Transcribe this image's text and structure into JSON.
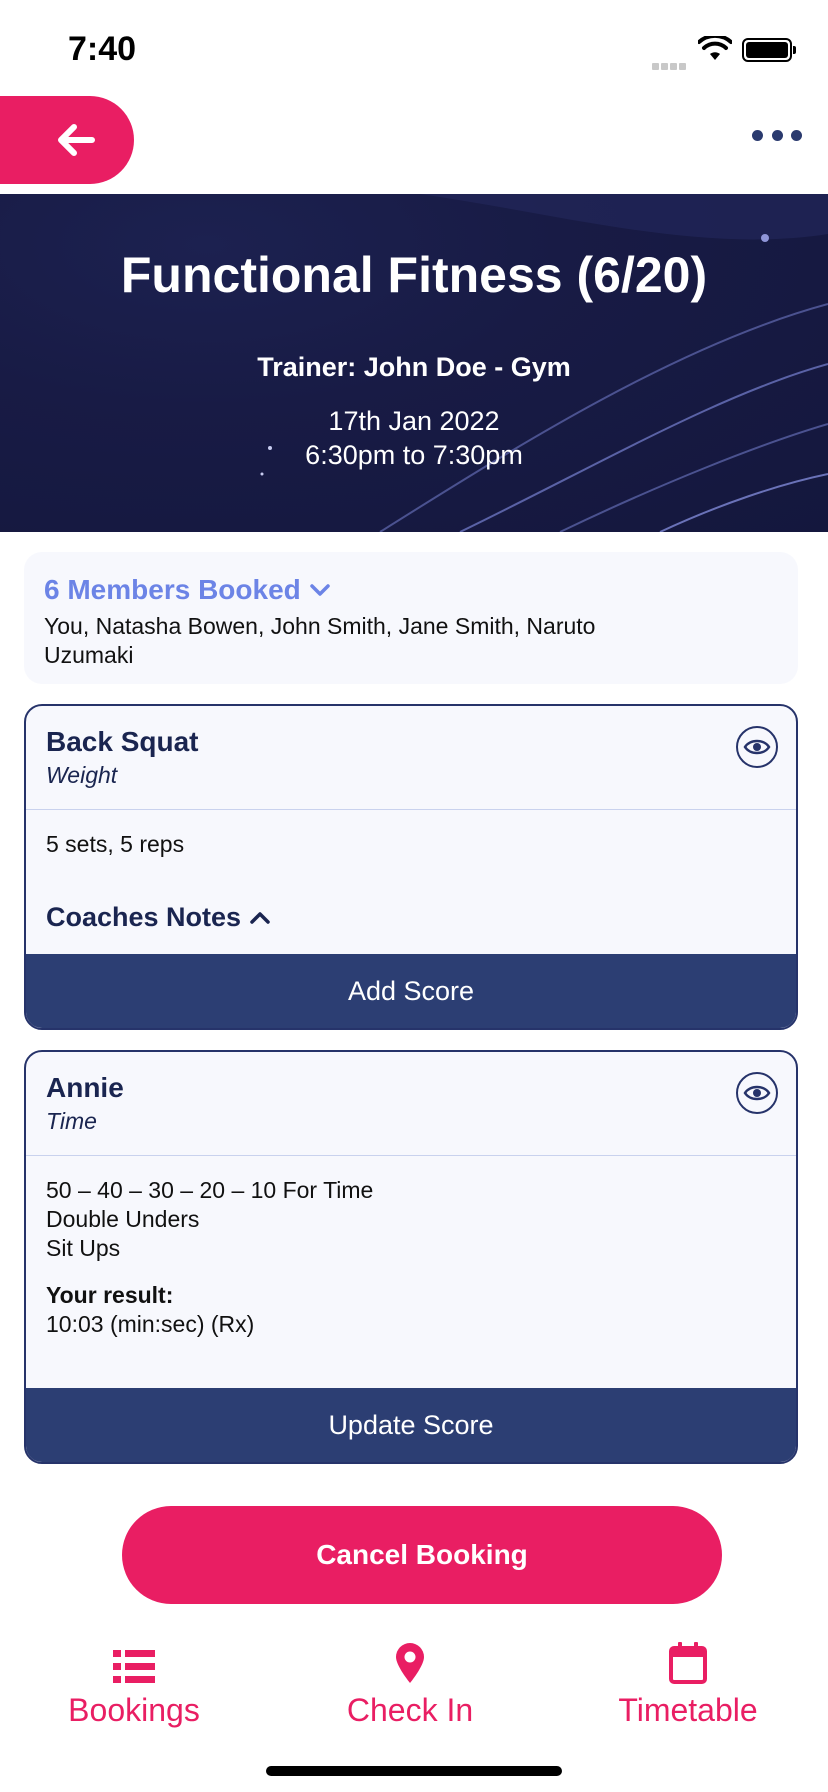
{
  "status_bar": {
    "time": "7:40"
  },
  "class": {
    "title": "Functional Fitness (6/20)",
    "trainer": "Trainer: John Doe - Gym",
    "date": "17th Jan 2022",
    "time_range": "6:30pm to 7:30pm"
  },
  "members": {
    "header": "6 Members Booked",
    "list": "You, Natasha Bowen, John Smith, Jane Smith, Naruto Uzumaki"
  },
  "workouts": [
    {
      "title": "Back Squat",
      "type": "Weight",
      "detail": "5 sets, 5 reps",
      "notes_label": "Coaches Notes",
      "button": "Add Score"
    },
    {
      "title": "Annie",
      "type": "Time",
      "lines": [
        "50 – 40 – 30 – 20 – 10 For Time",
        "Double Unders",
        "Sit Ups"
      ],
      "result_label": "Your result:",
      "result_value": "10:03 (min:sec)  (Rx)",
      "button": "Update Score"
    }
  ],
  "cancel_button": "Cancel Booking",
  "tabs": [
    {
      "label": "Bookings",
      "icon": "list-icon"
    },
    {
      "label": "Check In",
      "icon": "location-pin-icon"
    },
    {
      "label": "Timetable",
      "icon": "calendar-icon"
    }
  ],
  "colors": {
    "accent": "#e91e63",
    "navy": "#2c3e73",
    "link": "#6c84e6"
  }
}
